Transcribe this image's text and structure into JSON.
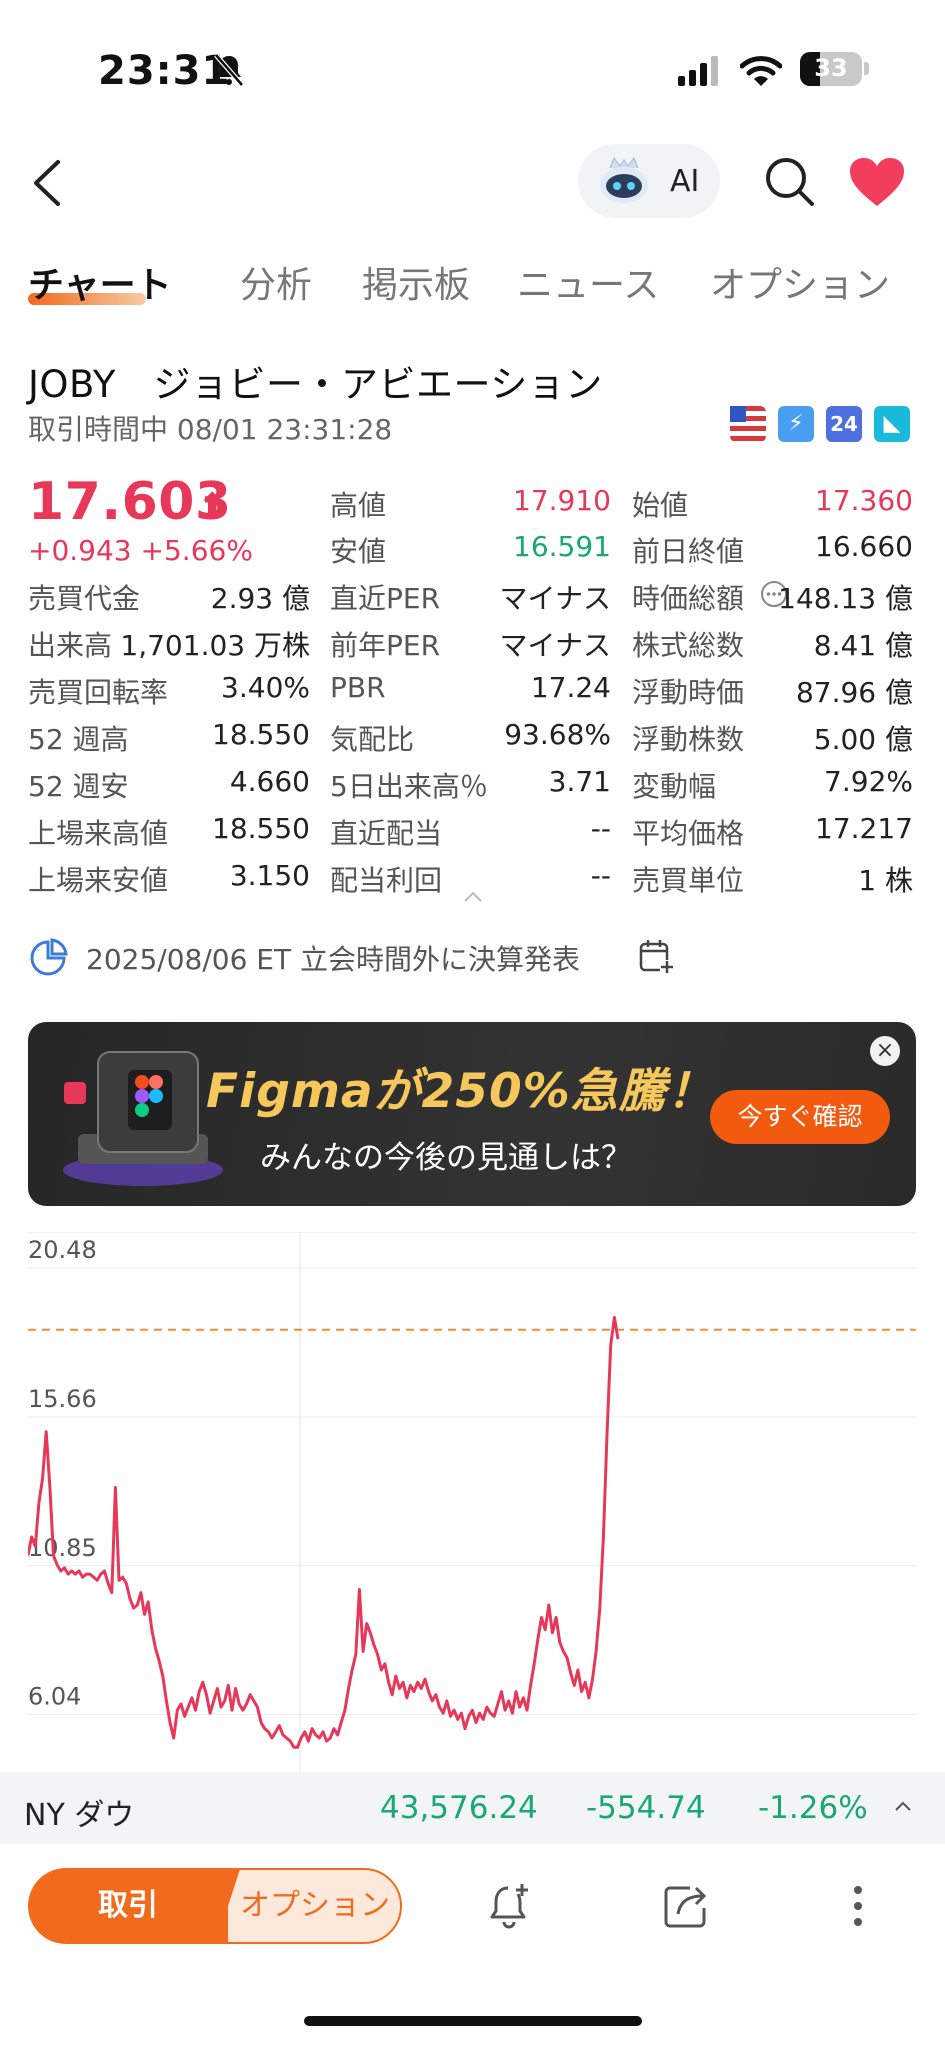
{
  "status_bar": {
    "time": "23:31",
    "battery": "33"
  },
  "nav": {
    "ai_label": "AI"
  },
  "tabs": [
    "チャート",
    "分析",
    "掲示板",
    "ニュース",
    "オプション"
  ],
  "stock": {
    "title": "JOBY　ジョビー・アビエーション",
    "status": "取引時間中 08/01 23:31:28",
    "price": "17.603",
    "change": "+0.943 +5.66%"
  },
  "stats": [
    [
      {
        "label": "売買代金",
        "value": "2.93 億"
      },
      {
        "label": "高値",
        "value": "17.910"
      },
      {
        "label": "始値",
        "value": "17.360"
      }
    ],
    [
      {
        "label": "出来高",
        "value": "1,701.03 万株"
      },
      {
        "label": "安値",
        "value": "16.591"
      },
      {
        "label": "前日終値",
        "value": "16.660"
      }
    ],
    [
      {
        "label": "売買回転率",
        "value": "3.40%"
      },
      {
        "label": "直近PER",
        "value": "マイナス"
      },
      {
        "label": "時価総額",
        "value": "148.13 億"
      }
    ],
    [
      {
        "label": "52 週高",
        "value": "18.550"
      },
      {
        "label": "前年PER",
        "value": "マイナス"
      },
      {
        "label": "株式総数",
        "value": "8.41 億"
      }
    ],
    [
      {
        "label": "52 週安",
        "value": "4.660"
      },
      {
        "label": "PBR",
        "value": "17.24"
      },
      {
        "label": "浮動時価",
        "value": "87.96 億"
      }
    ],
    [
      {
        "label": "上場来高値",
        "value": "18.550"
      },
      {
        "label": "気配比",
        "value": "93.68%"
      },
      {
        "label": "浮動株数",
        "value": "5.00 億"
      }
    ],
    [
      {
        "label": "上場来安値",
        "value": "3.150"
      },
      {
        "label": "5日出来高％",
        "value": "3.71"
      },
      {
        "label": "変動幅",
        "value": "7.92%"
      }
    ],
    [
      {
        "label": "",
        "value": ""
      },
      {
        "label": "直近配当",
        "value": "--"
      },
      {
        "label": "平均価格",
        "value": "17.217"
      }
    ],
    [
      {
        "label": "",
        "value": ""
      },
      {
        "label": "配当利回",
        "value": "--"
      },
      {
        "label": "売買単位",
        "value": "1 株"
      }
    ]
  ],
  "earnings": {
    "text": "2025/08/06 ET 立会時間外に決算発表"
  },
  "banner": {
    "line1": "Figmaが250%急騰！",
    "line2": "みんなの今後の見通しは？",
    "button": "今すぐ確認",
    "close": "×"
  },
  "chart_data": {
    "type": "line",
    "y_ticks": [
      "20.48",
      "15.66",
      "10.85",
      "6.04"
    ],
    "ylim": [
      3.6,
      20.48
    ],
    "reference_line": 17.9,
    "series_color": "#e8385a",
    "values": [
      10.6,
      11.2,
      10.9,
      12.3,
      13.1,
      14.6,
      12.8,
      10.6,
      10.3,
      10.1,
      10.2,
      10.0,
      10.1,
      10.0,
      10.1,
      9.9,
      10.0,
      10.0,
      9.9,
      9.8,
      10.0,
      10.1,
      9.7,
      9.4,
      12.8,
      9.8,
      9.9,
      9.7,
      9.2,
      8.9,
      9.0,
      9.4,
      8.7,
      9.1,
      8.2,
      7.6,
      7.2,
      6.7,
      5.9,
      5.2,
      4.7,
      5.6,
      5.8,
      5.4,
      5.7,
      6.0,
      5.6,
      6.2,
      6.5,
      6.1,
      5.5,
      5.9,
      6.3,
      5.7,
      5.9,
      6.4,
      5.6,
      6.3,
      5.8,
      5.6,
      5.8,
      6.1,
      5.9,
      5.7,
      5.2,
      5.0,
      4.9,
      4.7,
      4.9,
      5.1,
      4.8,
      4.7,
      4.6,
      4.4,
      4.4,
      4.7,
      4.9,
      4.6,
      5.0,
      4.8,
      4.7,
      4.9,
      4.6,
      4.7,
      5.0,
      4.8,
      5.2,
      5.6,
      6.3,
      6.9,
      7.4,
      9.5,
      7.5,
      8.4,
      8.1,
      7.7,
      7.4,
      6.9,
      7.1,
      6.5,
      6.1,
      6.7,
      6.3,
      6.5,
      6.0,
      6.4,
      6.2,
      6.5,
      6.3,
      6.6,
      6.2,
      5.9,
      6.1,
      5.7,
      5.5,
      5.9,
      5.4,
      5.6,
      5.3,
      5.5,
      5.0,
      5.4,
      5.6,
      5.2,
      5.5,
      5.3,
      5.7,
      5.5,
      5.4,
      5.8,
      6.2,
      5.6,
      5.9,
      5.5,
      6.2,
      5.7,
      6.0,
      5.6,
      6.4,
      7.1,
      7.9,
      8.6,
      8.2,
      9.0,
      8.1,
      8.6,
      7.8,
      7.5,
      7.3,
      6.8,
      6.4,
      6.9,
      6.2,
      6.5,
      6.0,
      6.6,
      7.5,
      8.9,
      11.2,
      14.6,
      17.4,
      18.3,
      17.6
    ]
  },
  "ticker": {
    "name": "NY ダウ",
    "value": "43,576.24",
    "change": "-554.74",
    "percent": "-1.26%"
  },
  "toolbar": {
    "trade": "取引",
    "option": "オプション"
  }
}
